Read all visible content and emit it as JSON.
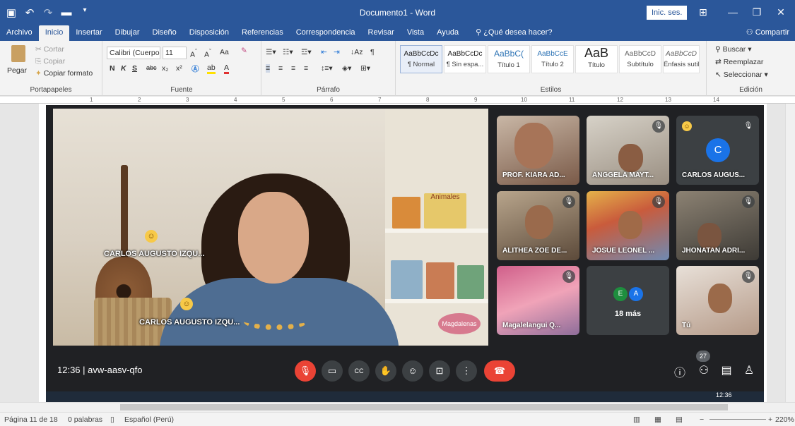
{
  "window": {
    "title": "Documento1 - Word",
    "signin_label": "Inic. ses.",
    "minimize": "—",
    "maximize": "❐",
    "close": "✕"
  },
  "ribbon_tabs": [
    "Archivo",
    "Inicio",
    "Insertar",
    "Dibujar",
    "Diseño",
    "Disposición",
    "Referencias",
    "Correspondencia",
    "Revisar",
    "Vista",
    "Ayuda"
  ],
  "tell_me": "¿Qué desea hacer?",
  "share": "Compartir",
  "clipboard": {
    "paste": "Pegar",
    "cut": "Cortar",
    "copy": "Copiar",
    "format_painter": "Copiar formato",
    "label": "Portapapeles"
  },
  "font": {
    "name": "Calibri (Cuerpo",
    "size": "11",
    "label": "Fuente",
    "bold": "N",
    "italic": "K",
    "underline": "S",
    "strike": "abc",
    "sub": "x₂",
    "sup": "x²",
    "aa": "Aa"
  },
  "paragraph": {
    "label": "Párrafo"
  },
  "styles": {
    "label": "Estilos",
    "items": [
      {
        "sample": "AaBbCcDc",
        "name": "¶ Normal"
      },
      {
        "sample": "AaBbCcDc",
        "name": "¶ Sin espa..."
      },
      {
        "sample": "AaBbC(",
        "name": "Título 1"
      },
      {
        "sample": "AaBbCcE",
        "name": "Título 2"
      },
      {
        "sample": "AaB",
        "name": "Título"
      },
      {
        "sample": "AaBbCcD",
        "name": "Subtítulo"
      },
      {
        "sample": "AaBbCcD",
        "name": "Énfasis sutil"
      }
    ]
  },
  "editing": {
    "find": "Buscar",
    "replace": "Reemplazar",
    "select": "Seleccionar",
    "label": "Edición"
  },
  "ruler_numbers": [
    "1",
    "2",
    "3",
    "4",
    "5",
    "6",
    "7",
    "8",
    "9",
    "10",
    "11",
    "12",
    "13",
    "14"
  ],
  "meet": {
    "main_labels": [
      "CARLOS AUGUSTO IZQU...",
      "CARLOS AUGUSTO IZQU..."
    ],
    "shelf_text": "Animales",
    "sign_text": "Magdalenas",
    "tiles": [
      {
        "name": "PROF. KIARA AD..."
      },
      {
        "name": "ANGGELA MAYT..."
      },
      {
        "name": "CARLOS AUGUS...",
        "avatar": "C"
      },
      {
        "name": "ALITHEA ZOE DE..."
      },
      {
        "name": "JOSUE LEONEL ..."
      },
      {
        "name": "JHONATAN ADRI..."
      },
      {
        "name": "Magalelangui Q..."
      },
      {
        "name": "18 más",
        "avatars": [
          "E",
          "A"
        ]
      },
      {
        "name": "Tú"
      }
    ],
    "time": "12:36",
    "meeting_code": "avw-aasv-qfo",
    "participants_badge": "27",
    "taskbar_clock": "12:36"
  },
  "status": {
    "page": "Página 11 de 18",
    "words": "0 palabras",
    "language": "Español (Perú)",
    "zoom": "220%",
    "zoom_minus": "−",
    "zoom_plus": "+"
  },
  "colors": {
    "word_blue": "#2b579a",
    "meet_bg": "#202124",
    "meet_red": "#ea4335",
    "avatar_blue": "#1a73e8"
  }
}
